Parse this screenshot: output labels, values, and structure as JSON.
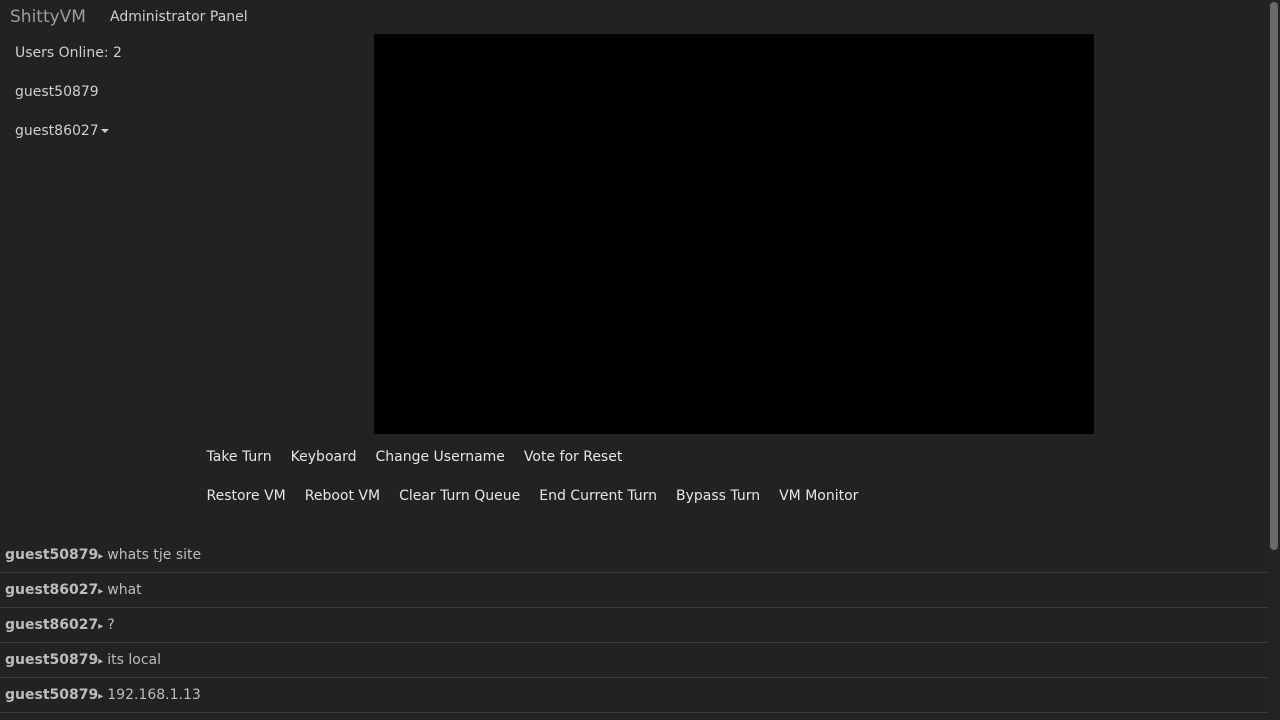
{
  "navbar": {
    "brand": "ShittyVM",
    "admin_link": "Administrator Panel"
  },
  "users": {
    "online_label": "Users Online: 2",
    "list": [
      {
        "name": "guest50879",
        "has_dropdown": false
      },
      {
        "name": "guest86027",
        "has_dropdown": true
      }
    ]
  },
  "controls": {
    "row1": [
      "Take Turn",
      "Keyboard",
      "Change Username",
      "Vote for Reset"
    ],
    "row2": [
      "Restore VM",
      "Reboot VM",
      "Clear Turn Queue",
      "End Current Turn",
      "Bypass Turn",
      "VM Monitor"
    ]
  },
  "chat": {
    "arrow_glyph": "▸",
    "messages": [
      {
        "user": "guest50879",
        "text": "whats tje site"
      },
      {
        "user": "guest86027",
        "text": "what"
      },
      {
        "user": "guest86027",
        "text": "?"
      },
      {
        "user": "guest50879",
        "text": "its local"
      },
      {
        "user": "guest50879",
        "text": "192.168.1.13"
      }
    ]
  },
  "colors": {
    "background": "#222222",
    "vm_screen": "#000000",
    "text": "#cfcfcf"
  }
}
